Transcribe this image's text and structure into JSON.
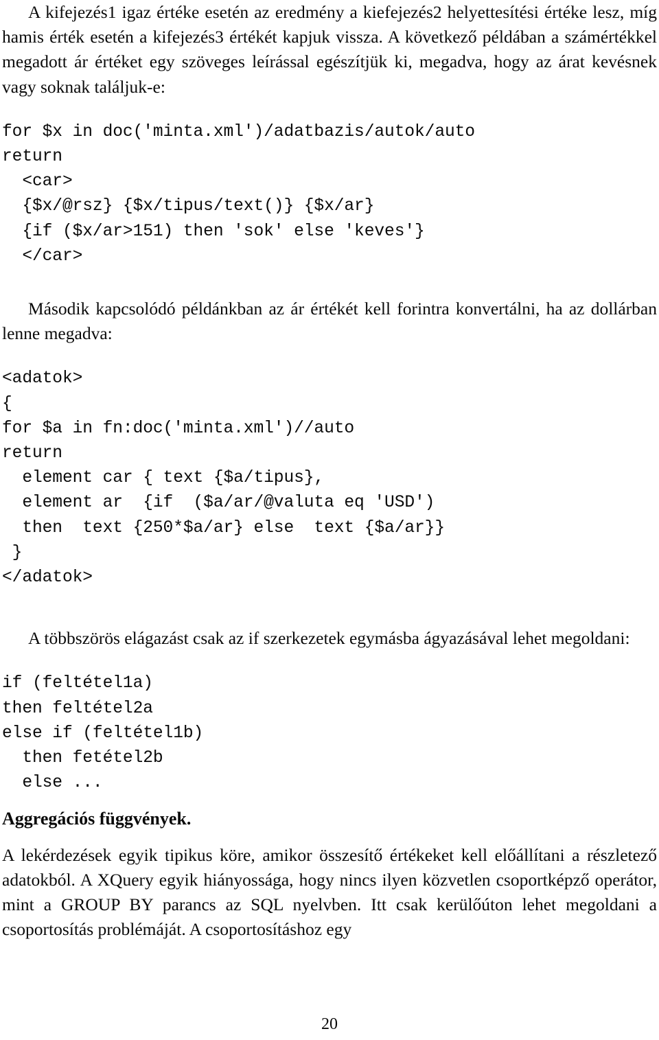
{
  "document": {
    "language": "hu",
    "page_number": "20",
    "text_color": "#0a0a0a",
    "background_color": "#ffffff"
  },
  "blocks": {
    "para1": "A kifejezés1 igaz értéke esetén az eredmény a kiefejezés2 helyettesítési értéke lesz, míg hamis érték esetén a kifejezés3 értékét kapjuk vissza. A következő példában a számértékkel megadott ár értéket egy szöveges leírással egészítjük ki, megadva, hogy az árat kevésnek vagy soknak találjuk-e:",
    "code1": "for $x in doc('minta.xml')/adatbazis/autok/auto\nreturn\n  <car>\n  {$x/@rsz} {$x/tipus/text()} {$x/ar}\n  {if ($x/ar>151) then 'sok' else 'keves'}\n  </car>",
    "para2": "Második kapcsolódó példánkban az ár értékét kell forintra konvertálni, ha az dollárban lenne megadva:",
    "code2": "<adatok>\n{\nfor $a in fn:doc('minta.xml')//auto\nreturn\n  element car { text {$a/tipus},\n  element ar  {if  ($a/ar/@valuta eq 'USD')\n  then  text {250*$a/ar} else  text {$a/ar}}\n }\n</adatok>",
    "para3": "A többszörös elágazást csak az if szerkezetek egymásba ágyazásával lehet megoldani:",
    "code3": "if (feltétel1a)\nthen feltétel2a\nelse if (feltétel1b)\n  then fetétel2b\n  else ...",
    "heading": "Aggregációs függvények.",
    "para4": "A lekérdezések egyik tipikus köre, amikor összesítő értékeket kell előállítani a részletező adatokból. A XQuery egyik hiányossága, hogy nincs ilyen közvetlen csoportképző operátor, mint a GROUP BY parancs az SQL nyelvben. Itt csak kerülőúton lehet megoldani a csoportosítás problémáját. A csoportosításhoz egy"
  }
}
